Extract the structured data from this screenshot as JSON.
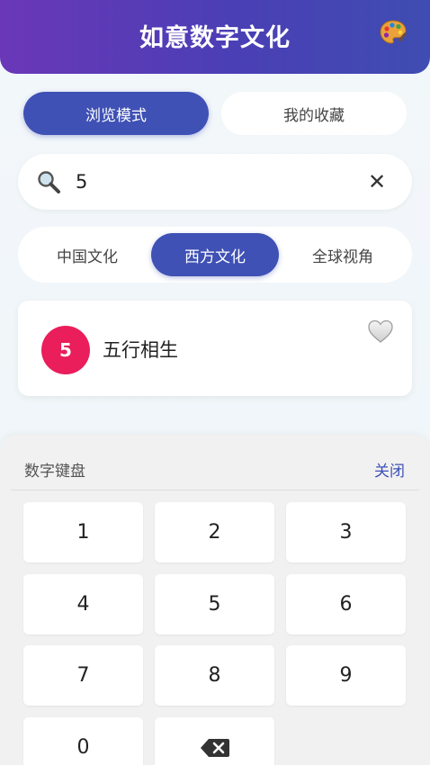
{
  "header": {
    "title": "如意数字文化",
    "palette_icon": "palette-icon"
  },
  "modes": [
    {
      "label": "浏览模式",
      "active": true
    },
    {
      "label": "我的收藏",
      "active": false
    }
  ],
  "search": {
    "value": "5",
    "search_icon": "magnifier-icon",
    "clear_label": "✕"
  },
  "categories": [
    {
      "label": "中国文化",
      "active": false
    },
    {
      "label": "西方文化",
      "active": true
    },
    {
      "label": "全球视角",
      "active": false
    }
  ],
  "results": [
    {
      "number": "5",
      "name": "五行相生",
      "badge_color": "#e91e5b",
      "favorited": false
    }
  ],
  "keyboard": {
    "title": "数字键盘",
    "close_label": "关闭",
    "keys": [
      "1",
      "2",
      "3",
      "4",
      "5",
      "6",
      "7",
      "8",
      "9",
      "0"
    ],
    "backspace_icon": "backspace-icon"
  },
  "colors": {
    "accent": "#3f51b5",
    "header_start": "#6a37b8",
    "header_end": "#3f4db2",
    "badge": "#e91e5b"
  }
}
